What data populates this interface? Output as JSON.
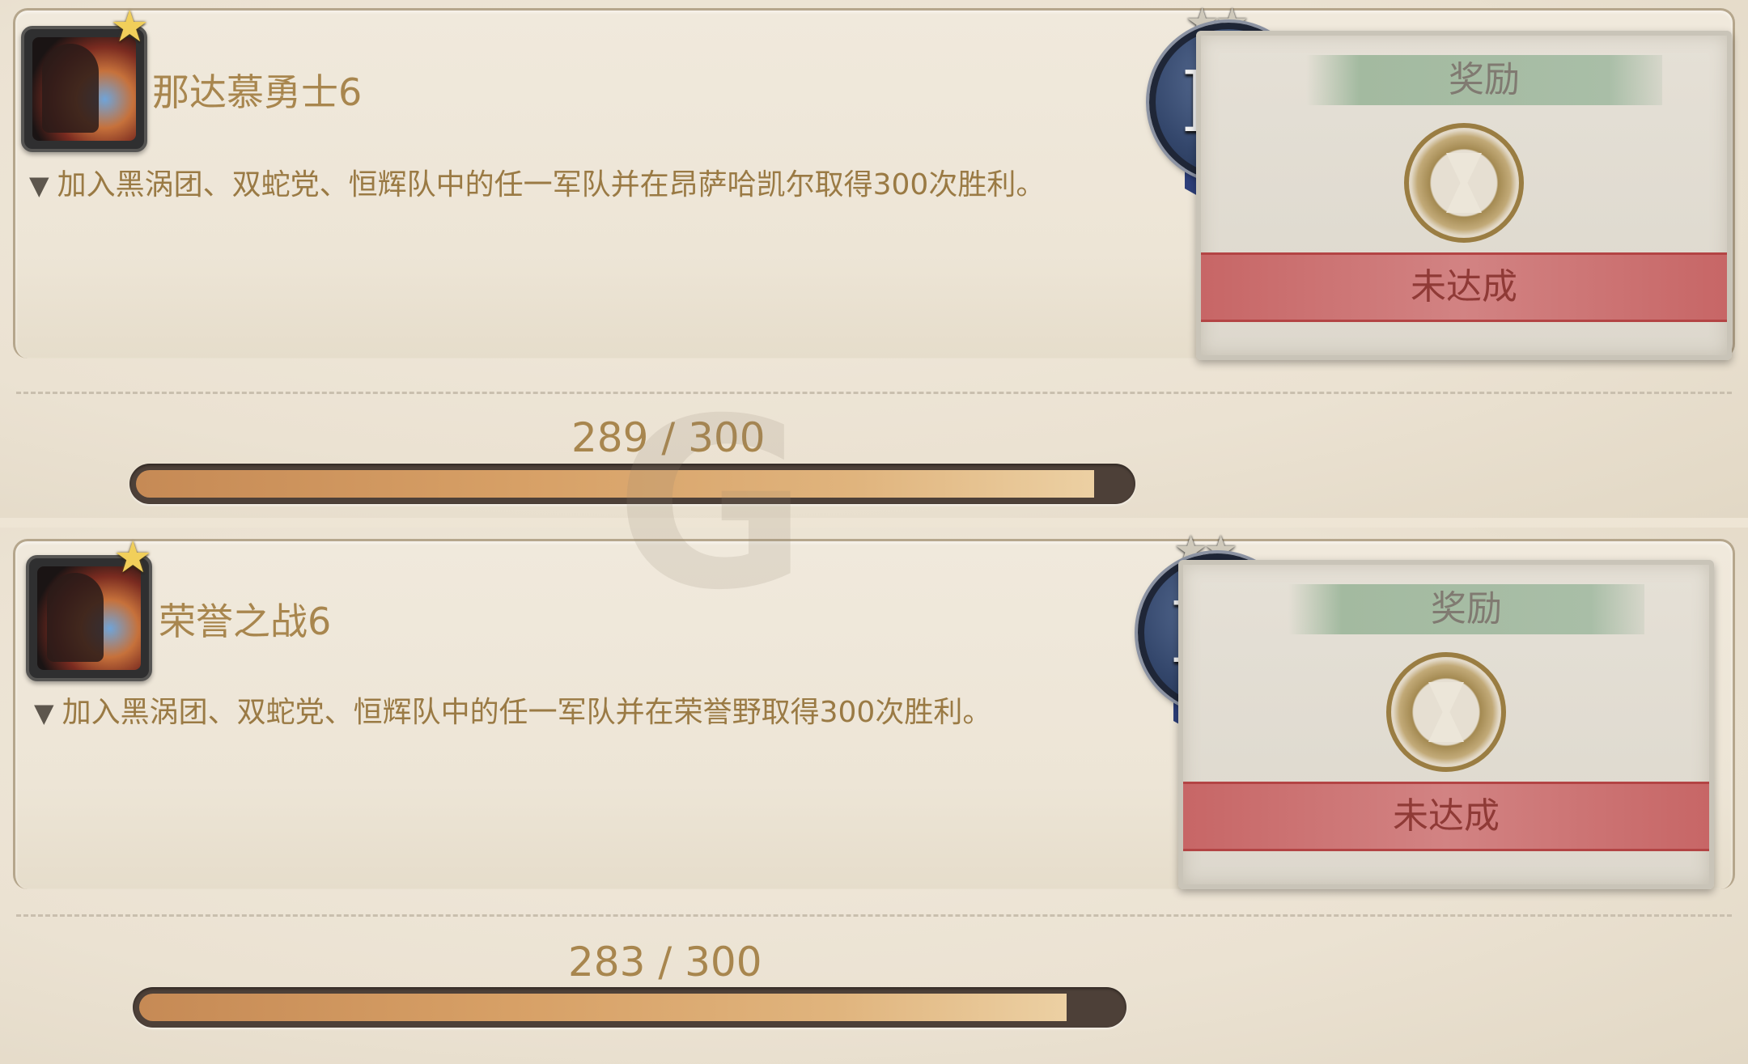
{
  "achievements": [
    {
      "title": "那达慕勇士6",
      "description": "加入黑涡团、双蛇党、恒辉队中的任一军队并在昂萨哈凯尔取得300次胜利。",
      "progress_current": 289,
      "progress_total": 300,
      "progress_text": "289 / 300",
      "progress_fraction": 0.963,
      "points": "IO",
      "reward_label": "奖励",
      "status_label": "未达成",
      "icon": "achievement-battle-icon",
      "medal_stars": "★★"
    },
    {
      "title": "荣誉之战6",
      "description": "加入黑涡团、双蛇党、恒辉队中的任一军队并在荣誉野取得300次胜利。",
      "progress_current": 283,
      "progress_total": 300,
      "progress_text": "283 / 300",
      "progress_fraction": 0.943,
      "points": "IO",
      "reward_label": "奖励",
      "status_label": "未达成",
      "icon": "achievement-battle-icon",
      "medal_stars": "★★"
    }
  ],
  "colors": {
    "title": "#a8864e",
    "bar_fill": "#d7a066",
    "status_band": "#c76666",
    "medal": "#34476c"
  }
}
